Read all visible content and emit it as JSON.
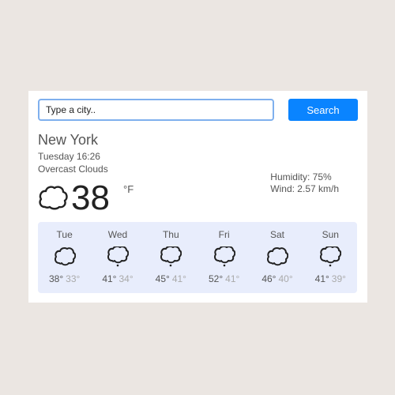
{
  "search": {
    "placeholder": "Type a city..",
    "button_label": "Search"
  },
  "current": {
    "city": "New York",
    "datetime": "Tuesday 16:26",
    "condition": "Overcast Clouds",
    "temperature": "38",
    "unit": "°F",
    "humidity": "Humidity: 75%",
    "wind": "Wind: 2.57 km/h",
    "icon": "cloud-icon"
  },
  "forecast": [
    {
      "day": "Tue",
      "high": "38°",
      "low": "33°",
      "icon": "cloud-icon"
    },
    {
      "day": "Wed",
      "high": "41°",
      "low": "34°",
      "icon": "cloud-drizzle-icon"
    },
    {
      "day": "Thu",
      "high": "45°",
      "low": "41°",
      "icon": "cloud-drizzle-icon"
    },
    {
      "day": "Fri",
      "high": "52°",
      "low": "41°",
      "icon": "cloud-drizzle-icon"
    },
    {
      "day": "Sat",
      "high": "46°",
      "low": "40°",
      "icon": "cloud-icon"
    },
    {
      "day": "Sun",
      "high": "41°",
      "low": "39°",
      "icon": "cloud-drizzle-icon"
    }
  ],
  "colors": {
    "accent": "#0a84ff",
    "forecast_bg": "#e8edfc",
    "page_bg": "#ebe6e2"
  }
}
